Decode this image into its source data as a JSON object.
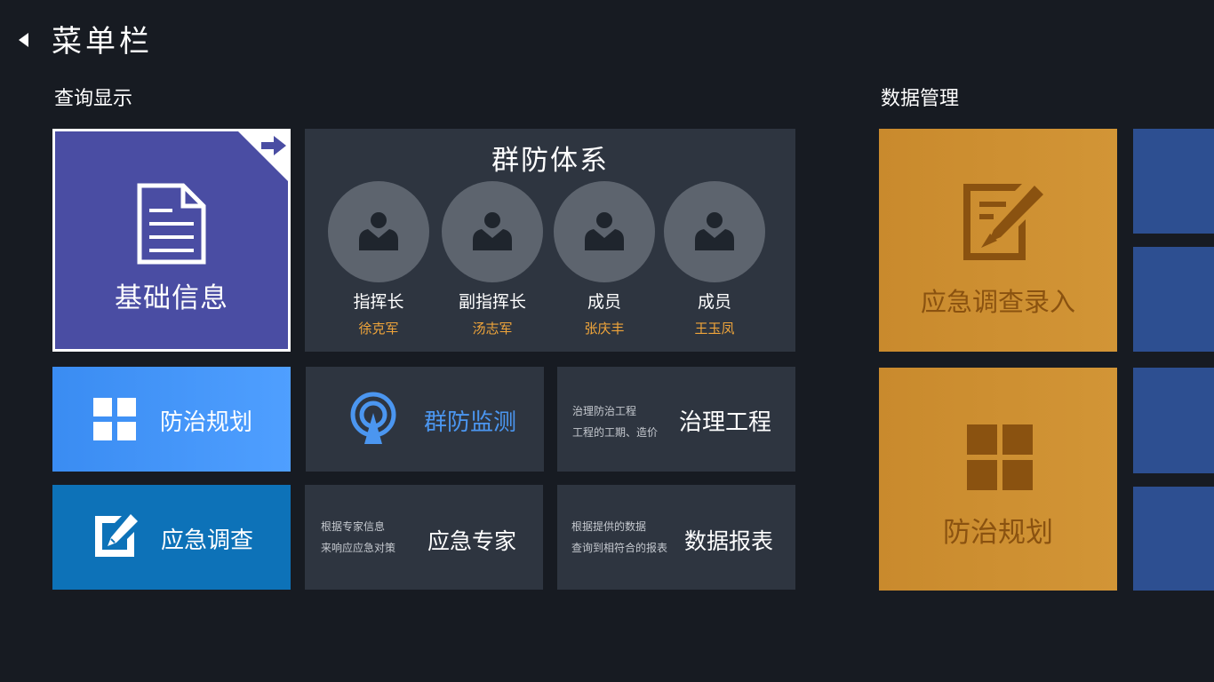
{
  "header": {
    "title": "菜单栏",
    "back_icon": "back-triangle-icon"
  },
  "sections": {
    "query": "查询显示",
    "data_mgmt": "数据管理"
  },
  "tiles": {
    "basic_info": {
      "label": "基础信息",
      "icon": "document-icon",
      "corner_icon": "arrow-right-icon",
      "color": "#4a4da3"
    },
    "defense_system": {
      "title": "群防体系",
      "members": [
        {
          "role": "指挥长",
          "name": "徐克军"
        },
        {
          "role": "副指挥长",
          "name": "汤志军"
        },
        {
          "role": "成员",
          "name": "张庆丰"
        },
        {
          "role": "成员",
          "name": "王玉凤"
        }
      ],
      "name_color": "#f0a53a"
    },
    "prevention_plan": {
      "label": "防治规划",
      "icon": "windows-grid-icon",
      "color": "#3a8cf2"
    },
    "monitoring": {
      "label": "群防监测",
      "icon": "broadcast-icon",
      "color": "#4b96f0"
    },
    "engineering": {
      "label": "治理工程",
      "desc1": "治理防治工程",
      "desc2": "工程的工期、造价"
    },
    "emergency_survey": {
      "label": "应急调查",
      "icon": "edit-icon",
      "color": "#0d72b8"
    },
    "experts": {
      "label": "应急专家",
      "desc1": "根据专家信息",
      "desc2": "来响应应急对策"
    },
    "reports": {
      "label": "数据报表",
      "desc1": "根据提供的数据",
      "desc2": "查询到相符合的报表"
    },
    "survey_input": {
      "label": "应急调查录入",
      "icon": "edit-form-icon",
      "color": "#c98a2d"
    },
    "prevention_plan_2": {
      "label": "防治规划",
      "icon": "windows-grid-icon",
      "color": "#c98a2d"
    }
  }
}
